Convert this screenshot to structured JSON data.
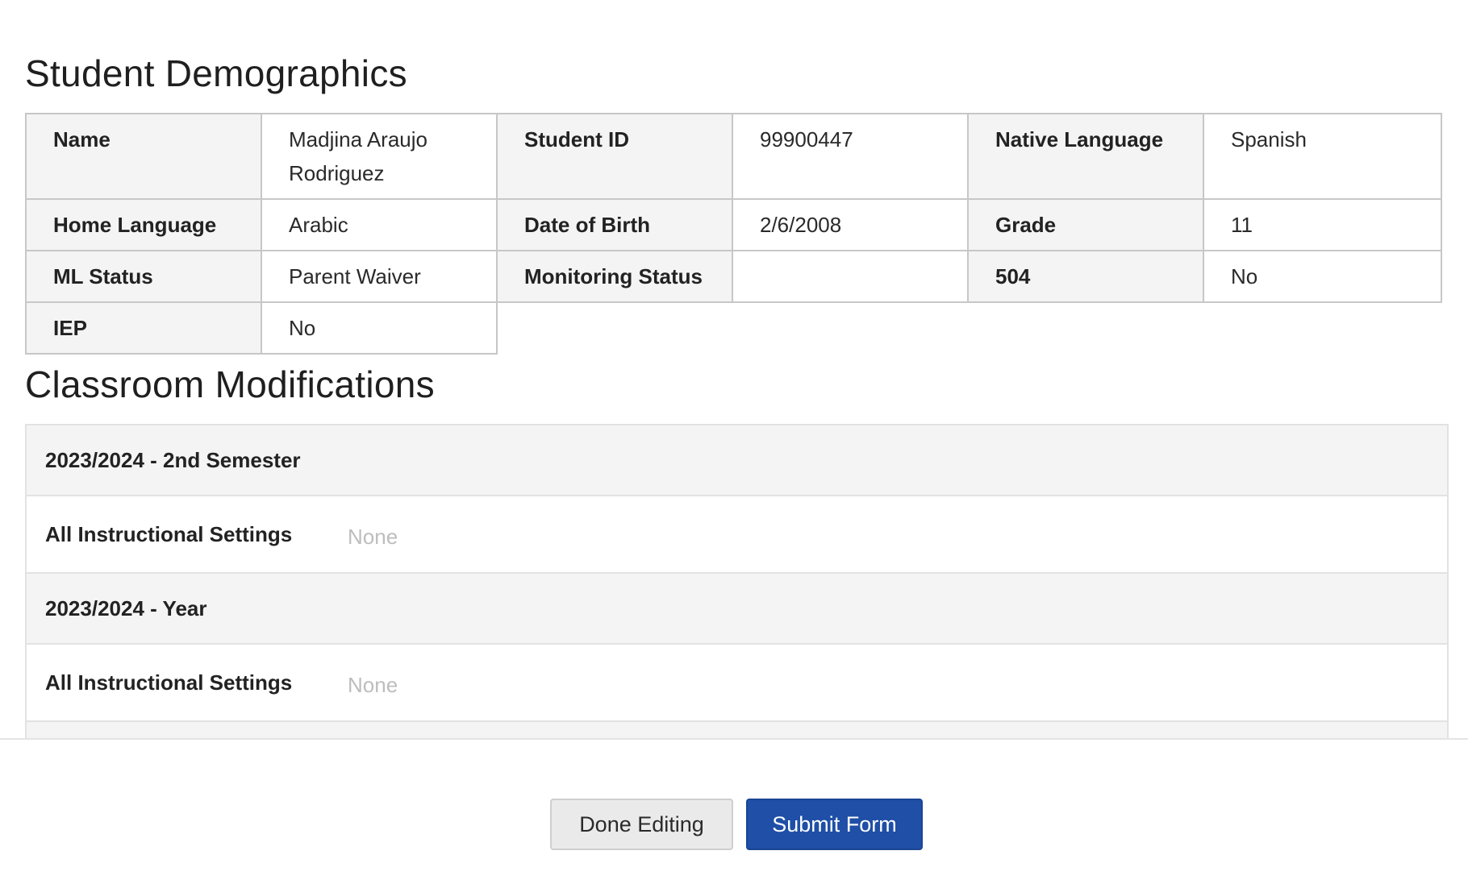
{
  "demographics": {
    "title": "Student Demographics",
    "fields": {
      "name": {
        "label": "Name",
        "value": "Madjina Araujo Rodriguez"
      },
      "student_id": {
        "label": "Student ID",
        "value": "99900447"
      },
      "native_language": {
        "label": "Native Language",
        "value": "Spanish"
      },
      "home_language": {
        "label": "Home Language",
        "value": "Arabic"
      },
      "date_of_birth": {
        "label": "Date of Birth",
        "value": "2/6/2008"
      },
      "grade": {
        "label": "Grade",
        "value": "11"
      },
      "ml_status": {
        "label": "ML Status",
        "value": "Parent Waiver"
      },
      "monitoring_status": {
        "label": "Monitoring Status",
        "value": ""
      },
      "section_504": {
        "label": "504",
        "value": "No"
      },
      "iep": {
        "label": "IEP",
        "value": "No"
      }
    }
  },
  "modifications": {
    "title": "Classroom Modifications",
    "groups": [
      {
        "period": "2023/2024 - 2nd Semester",
        "setting_label": "All Instructional Settings",
        "setting_value": "None"
      },
      {
        "period": "2023/2024 - Year",
        "setting_label": "All Instructional Settings",
        "setting_value": "None"
      }
    ]
  },
  "footer": {
    "done_label": "Done Editing",
    "submit_label": "Submit Form"
  }
}
